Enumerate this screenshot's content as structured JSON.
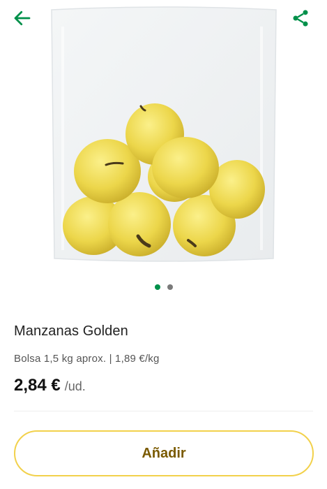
{
  "product": {
    "name": "Manzanas Golden",
    "description": "Bolsa 1,5 kg aprox. | 1,89 €/kg",
    "price": "2,84 €",
    "unit": "/ud."
  },
  "actions": {
    "add_label": "Añadir"
  },
  "gallery": {
    "image_count": 2,
    "active_index": 0
  },
  "icons": {
    "back": "arrow-left-icon",
    "share": "share-icon"
  },
  "colors": {
    "accent": "#00904a",
    "button_border": "#f2d14b",
    "button_text": "#7a5a00"
  }
}
